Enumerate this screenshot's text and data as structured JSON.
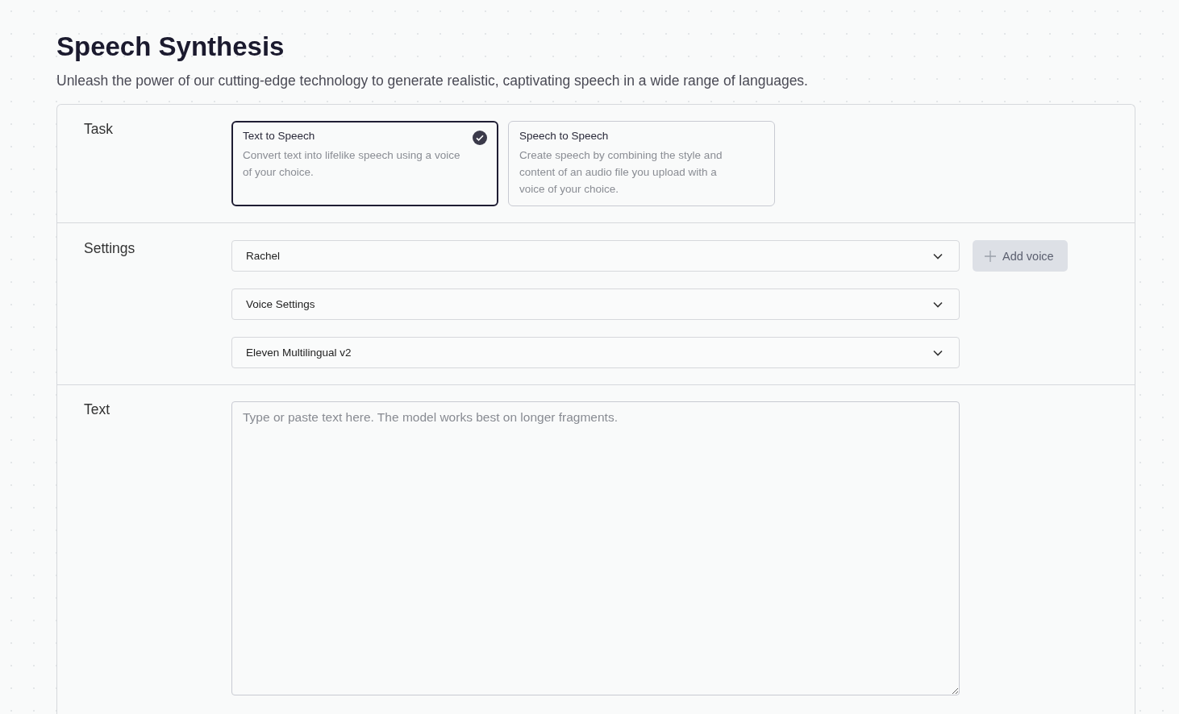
{
  "title": "Speech Synthesis",
  "subtitle": "Unleash the power of our cutting-edge technology to generate realistic, captivating speech in a wide range of languages.",
  "task": {
    "label": "Task",
    "options": [
      {
        "title": "Text to Speech",
        "description": "Convert text into lifelike speech using a voice of your choice.",
        "selected": true
      },
      {
        "title": "Speech to Speech",
        "description": "Create speech by combining the style and content of an audio file you upload with a voice of your choice.",
        "selected": false
      }
    ]
  },
  "settings": {
    "label": "Settings",
    "dropdowns": [
      "Rachel",
      "Voice Settings",
      "Eleven Multilingual v2"
    ],
    "add_button": "Add voice"
  },
  "text": {
    "label": "Text",
    "placeholder": "Type or paste text here. The model works best on longer fragments."
  }
}
